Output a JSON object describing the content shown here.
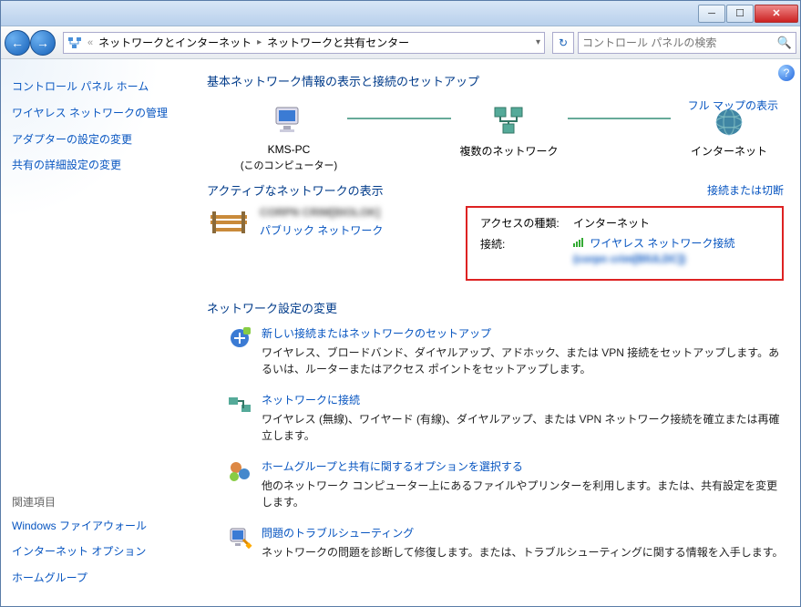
{
  "breadcrumb": {
    "parent": "ネットワークとインターネット",
    "current": "ネットワークと共有センター"
  },
  "search": {
    "placeholder": "コントロール パネルの検索"
  },
  "sidebar": {
    "home": "コントロール パネル ホーム",
    "links": [
      "ワイヤレス ネットワークの管理",
      "アダプターの設定の変更",
      "共有の詳細設定の変更"
    ],
    "related_heading": "関連項目",
    "related": [
      "Windows ファイアウォール",
      "インターネット オプション",
      "ホームグループ"
    ]
  },
  "main": {
    "title": "基本ネットワーク情報の表示と接続のセットアップ",
    "full_map": "フル マップの表示",
    "nodes": {
      "computer_name": "KMS-PC",
      "computer_sub": "(このコンピューター)",
      "middle": "複数のネットワーク",
      "internet": "インターネット"
    },
    "active_section": {
      "title": "アクティブなネットワークの表示",
      "link": "接続または切断",
      "network_name": "CORPN CRIM[BIOLOK]",
      "network_type": "パブリック ネットワーク",
      "access_label": "アクセスの種類:",
      "access_value": "インターネット",
      "conn_label": "接続:",
      "conn_value": "ワイヤレス ネットワーク接続",
      "conn_detail": "(corpn crim[BlULDC])"
    },
    "change_settings_title": "ネットワーク設定の変更",
    "settings": [
      {
        "title": "新しい接続またはネットワークのセットアップ",
        "desc": "ワイヤレス、ブロードバンド、ダイヤルアップ、アドホック、または VPN 接続をセットアップします。あるいは、ルーターまたはアクセス ポイントをセットアップします。"
      },
      {
        "title": "ネットワークに接続",
        "desc": "ワイヤレス (無線)、ワイヤード (有線)、ダイヤルアップ、または VPN ネットワーク接続を確立または再確立します。"
      },
      {
        "title": "ホームグループと共有に関するオプションを選択する",
        "desc": "他のネットワーク コンピューター上にあるファイルやプリンターを利用します。または、共有設定を変更します。"
      },
      {
        "title": "問題のトラブルシューティング",
        "desc": "ネットワークの問題を診断して修復します。または、トラブルシューティングに関する情報を入手します。"
      }
    ]
  }
}
